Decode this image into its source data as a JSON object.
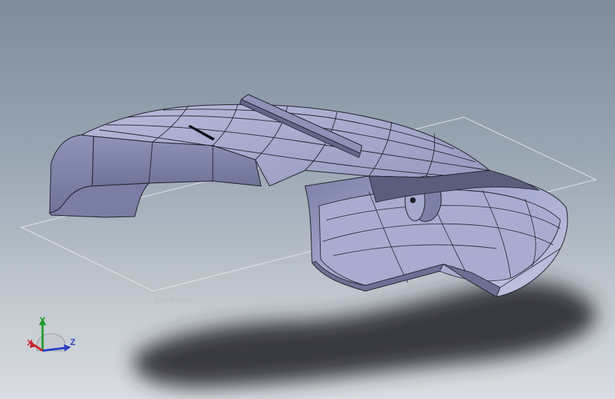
{
  "viewport": {
    "plane_label": "Top Plane",
    "triad": {
      "x": "X",
      "y": "Y",
      "z": "Z"
    }
  },
  "colors": {
    "model_face": "#9ea3c4",
    "model_face_dark": "#6e7296",
    "edge": "#1c1d26",
    "axis_x": "#c7242a",
    "axis_y": "#1e9a2a",
    "axis_z": "#2b3fc4"
  }
}
